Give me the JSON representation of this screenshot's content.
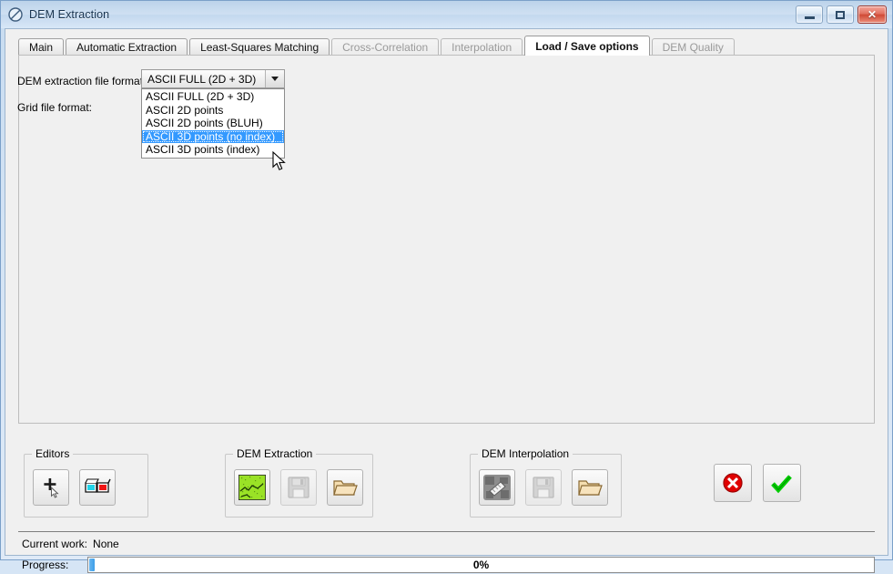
{
  "window": {
    "title": "DEM Extraction",
    "icon": "dem-circle-slash-icon",
    "controls": {
      "minimize": "–",
      "maximize": "□",
      "close": "✕"
    }
  },
  "tabs": [
    {
      "label": "Main",
      "state": "enabled"
    },
    {
      "label": "Automatic Extraction",
      "state": "enabled"
    },
    {
      "label": "Least-Squares Matching",
      "state": "enabled"
    },
    {
      "label": "Cross-Correlation",
      "state": "disabled"
    },
    {
      "label": "Interpolation",
      "state": "disabled"
    },
    {
      "label": "Load / Save options",
      "state": "active"
    },
    {
      "label": "DEM Quality",
      "state": "disabled"
    }
  ],
  "page": {
    "dem_format_label": "DEM extraction file format:",
    "grid_format_label": "Grid file format:",
    "combo": {
      "value": "ASCII FULL (2D + 3D)",
      "arrow_icon": "chevron-down-icon",
      "options": [
        "ASCII FULL (2D + 3D)",
        "ASCII 2D points",
        "ASCII 2D points (BLUH)",
        "ASCII 3D points (no index)",
        "ASCII 3D points (index)"
      ],
      "highlighted_index": 3,
      "highlight_color": "#3399ff"
    }
  },
  "groups": {
    "editors": {
      "title": "Editors",
      "buttons": [
        {
          "name": "add-point-editor",
          "icon": "plus-cursor-icon"
        },
        {
          "name": "stereo-editor",
          "icon": "anaglyph-glasses-icon"
        }
      ]
    },
    "dem_extraction": {
      "title": "DEM Extraction",
      "buttons": [
        {
          "name": "run-extraction",
          "icon": "green-terrain-icon",
          "enabled": true
        },
        {
          "name": "save-extraction",
          "icon": "floppy-save-icon",
          "enabled": false
        },
        {
          "name": "open-extraction",
          "icon": "open-folder-icon",
          "enabled": true
        }
      ]
    },
    "dem_interpolation": {
      "title": "DEM Interpolation",
      "buttons": [
        {
          "name": "run-interpolation",
          "icon": "gray-terrain-icon",
          "enabled": true
        },
        {
          "name": "save-interpolation",
          "icon": "floppy-save-icon",
          "enabled": false
        },
        {
          "name": "open-interpolation",
          "icon": "open-folder-icon",
          "enabled": true
        }
      ]
    }
  },
  "actions": {
    "cancel": {
      "icon": "red-cancel-icon",
      "color": "#e00000"
    },
    "ok": {
      "icon": "green-check-icon",
      "color": "#00cc00"
    }
  },
  "status": {
    "current_work_label": "Current work:",
    "current_work_value": "None",
    "progress_label": "Progress:",
    "progress_text": "0%",
    "progress_percent": 0
  }
}
